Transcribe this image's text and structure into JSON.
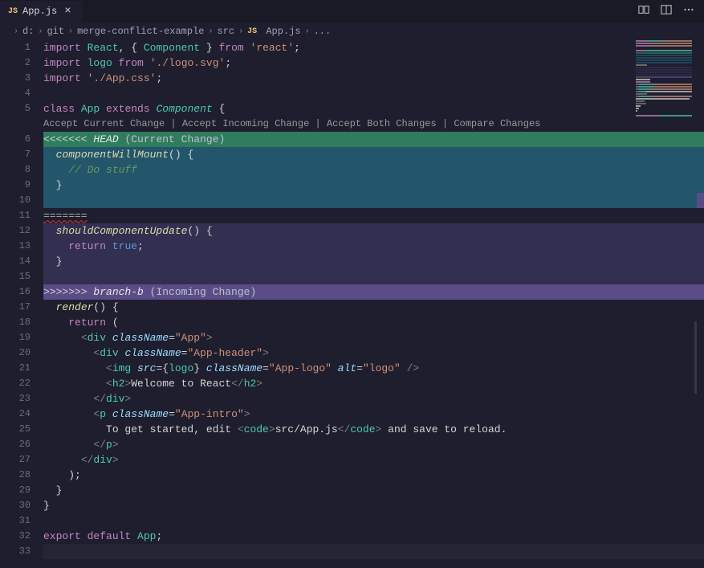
{
  "tab": {
    "icon": "JS",
    "name": "App.js"
  },
  "breadcrumb": [
    "d:",
    "git",
    "merge-conflict-example",
    "src",
    "App.js",
    "..."
  ],
  "breadcrumb_icon": "JS",
  "codelens": {
    "accept_current": "Accept Current Change",
    "accept_incoming": "Accept Incoming Change",
    "accept_both": "Accept Both Changes",
    "compare": "Compare Changes"
  },
  "conflict": {
    "head_marker": "<<<<<<< ",
    "head_label": "HEAD",
    "head_paren": " (Current Change)",
    "sep": "=======",
    "inc_marker": ">>>>>>> ",
    "inc_label": "branch-b",
    "inc_paren": " (Incoming Change)"
  },
  "code": {
    "l1_import": "import",
    "l1_react": "React",
    "l1_comp": "Component",
    "l1_from": "from",
    "l1_str": "'react'",
    "l2_logo": "logo",
    "l2_str": "'./logo.svg'",
    "l3_str": "'./App.css'",
    "l5_class": "class",
    "l5_app": "App",
    "l5_ext": "extends",
    "l5_comp": "Component",
    "l7_fn": "componentWillMount",
    "l8_comment": "// Do stuff",
    "l12_fn": "shouldComponentUpdate",
    "l13_ret": "return",
    "l13_true": "true",
    "l17_fn": "render",
    "l18_ret": "return",
    "l19_div": "div",
    "l19_cn": "className",
    "l19_app": "\"App\"",
    "l20_div": "div",
    "l20_cn": "className",
    "l20_hdr": "\"App-header\"",
    "l21_img": "img",
    "l21_src": "src",
    "l21_logo": "logo",
    "l21_cn": "className",
    "l21_al": "\"App-logo\"",
    "l21_alt": "alt",
    "l21_lv": "\"logo\"",
    "l22_h2": "h2",
    "l22_txt": "Welcome to React",
    "l23_div": "div",
    "l24_p": "p",
    "l24_cn": "className",
    "l24_ai": "\"App-intro\"",
    "l25_txt1": "To get started, edit ",
    "l25_code": "code",
    "l25_path": "src/App.js",
    "l25_txt2": " and save to reload.",
    "l26_p": "p",
    "l27_div": "div",
    "l32_exp": "export",
    "l32_def": "default",
    "l32_app": "App"
  },
  "line_numbers": [
    "1",
    "2",
    "3",
    "4",
    "5",
    "",
    "6",
    "7",
    "8",
    "9",
    "10",
    "11",
    "12",
    "13",
    "14",
    "15",
    "16",
    "17",
    "18",
    "19",
    "20",
    "21",
    "22",
    "23",
    "24",
    "25",
    "26",
    "27",
    "28",
    "29",
    "30",
    "31",
    "32",
    "33"
  ]
}
